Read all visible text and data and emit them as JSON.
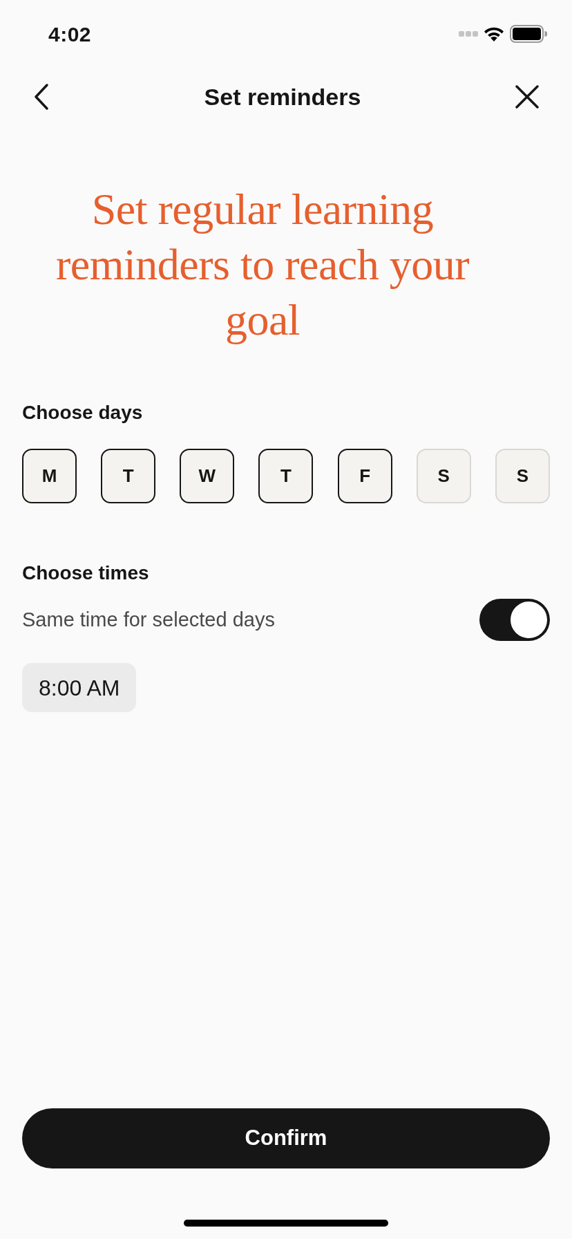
{
  "status_bar": {
    "time": "4:02"
  },
  "header": {
    "title": "Set reminders"
  },
  "heading": "Set regular learning reminders to reach your goal",
  "days_section": {
    "label": "Choose days",
    "days": [
      {
        "label": "M",
        "selected": true
      },
      {
        "label": "T",
        "selected": true
      },
      {
        "label": "W",
        "selected": true
      },
      {
        "label": "T",
        "selected": true
      },
      {
        "label": "F",
        "selected": true
      },
      {
        "label": "S",
        "selected": false
      },
      {
        "label": "S",
        "selected": false
      }
    ]
  },
  "times_section": {
    "label": "Choose times",
    "same_time": {
      "label": "Same time for selected days",
      "on": true
    },
    "times": [
      "8:00 AM"
    ]
  },
  "confirm_button": {
    "label": "Confirm"
  }
}
